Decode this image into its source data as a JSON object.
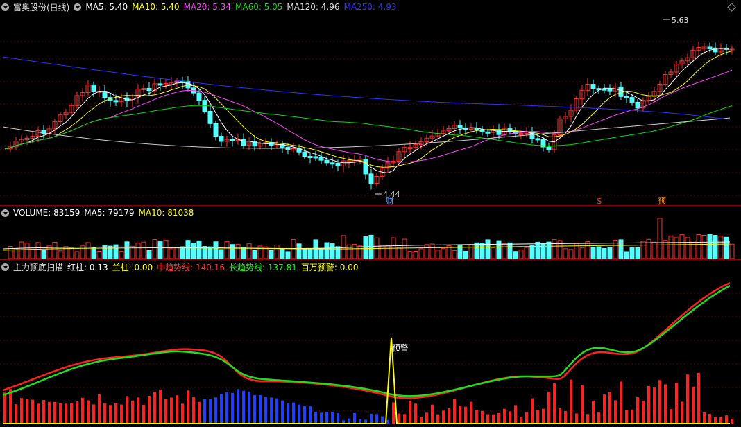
{
  "main_panel": {
    "title": "富奥股份(日线)",
    "ma": [
      {
        "label": "MA5: 5.40",
        "color": "#ffffff"
      },
      {
        "label": "MA10: 5.40",
        "color": "#ffff00"
      },
      {
        "label": "MA20: 5.34",
        "color": "#ff44ff"
      },
      {
        "label": "MA60: 5.05",
        "color": "#00dd00"
      },
      {
        "label": "MA120: 4.96",
        "color": "#dddddd"
      },
      {
        "label": "MA250: 4.93",
        "color": "#3030ff"
      }
    ],
    "high_label": "5.63",
    "low_label": "4.44",
    "markers": [
      {
        "text": "财",
        "color": "#4fa0ff"
      },
      {
        "text": "$",
        "color": "#ff3030"
      },
      {
        "text": "预",
        "color": "#ff9900"
      }
    ]
  },
  "volume_panel": {
    "items": [
      {
        "label": "VOLUME: 83159",
        "color": "#ffffff"
      },
      {
        "label": "MA5: 79179",
        "color": "#ffffff"
      },
      {
        "label": "MA10: 81038",
        "color": "#ffff00"
      }
    ]
  },
  "indicator_panel": {
    "title": "主力顶底扫描",
    "items": [
      {
        "label": "红柱: 0.13",
        "color": "#ffffff"
      },
      {
        "label": "兰柱: 0.00",
        "color": "#ffff00"
      },
      {
        "label": "中趋势线: 140.16",
        "color": "#ff3030"
      },
      {
        "label": "长趋势线: 137.81",
        "color": "#00ff00"
      },
      {
        "label": "百万预警: 0.00",
        "color": "#ffff00"
      }
    ],
    "alert_label": "预警"
  },
  "colors": {
    "up": "#ff3030",
    "down": "#54ffff",
    "bg": "#000000",
    "grid": "#8a0000"
  }
}
